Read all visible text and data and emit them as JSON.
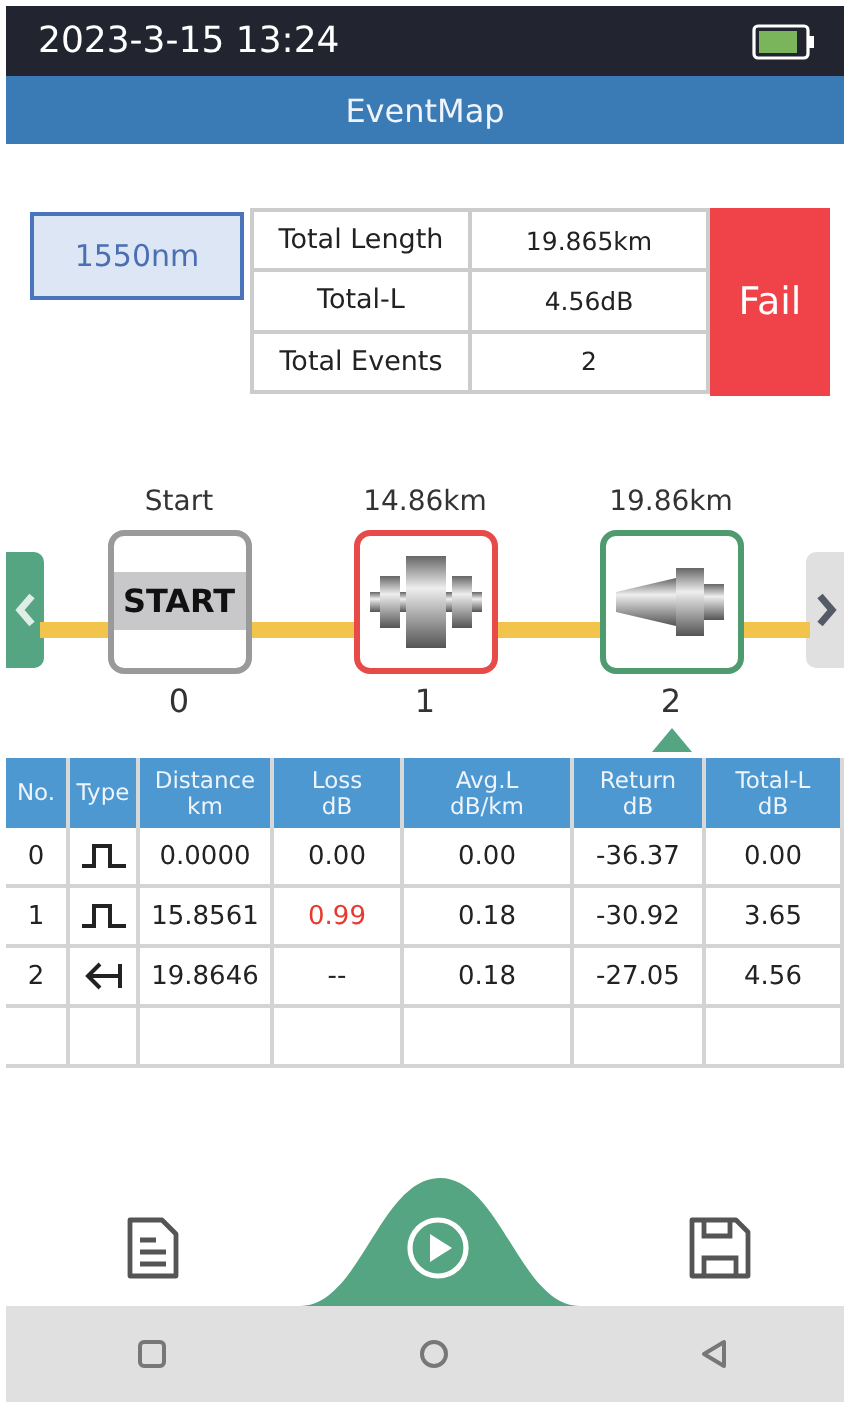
{
  "status_bar": {
    "time": "2023-3-15 13:24"
  },
  "title": "EventMap",
  "wavelength": "1550nm",
  "summary": [
    {
      "label": "Total Length",
      "value": "19.865km"
    },
    {
      "label": "Total-L",
      "value": "4.56dB"
    },
    {
      "label": "Total  Events",
      "value": "2"
    }
  ],
  "verdict": {
    "text": "Fail",
    "pass": false
  },
  "event_map": {
    "events": [
      {
        "distance": "Start",
        "number": "0",
        "kind": "start",
        "label": "START",
        "color": "#9a9a9a",
        "selected": false
      },
      {
        "distance": "14.86km",
        "number": "1",
        "kind": "connector",
        "color": "#e84a4a",
        "selected": false
      },
      {
        "distance": "19.86km",
        "number": "2",
        "kind": "end",
        "color": "#4f9a6e",
        "selected": true
      }
    ]
  },
  "table": {
    "columns": [
      {
        "name": "No."
      },
      {
        "name": "Type"
      },
      {
        "name": "Distance",
        "unit": "km"
      },
      {
        "name": "Loss",
        "unit": "dB"
      },
      {
        "name": "Avg.L",
        "unit": "dB/km"
      },
      {
        "name": "Return",
        "unit": "dB"
      },
      {
        "name": "Total-L",
        "unit": "dB"
      }
    ],
    "rows": [
      {
        "no": "0",
        "kind": "reflective",
        "distance": "0.0000",
        "loss": "0.00",
        "loss_fail": false,
        "avg": "0.00",
        "return": "-36.37",
        "total": "0.00"
      },
      {
        "no": "1",
        "kind": "reflective",
        "distance": "15.8561",
        "loss": "0.99",
        "loss_fail": true,
        "avg": "0.18",
        "return": "-30.92",
        "total": "3.65"
      },
      {
        "no": "2",
        "kind": "end",
        "distance": "19.8646",
        "loss": "--",
        "loss_fail": false,
        "avg": "0.18",
        "return": "-27.05",
        "total": "4.56"
      }
    ]
  }
}
